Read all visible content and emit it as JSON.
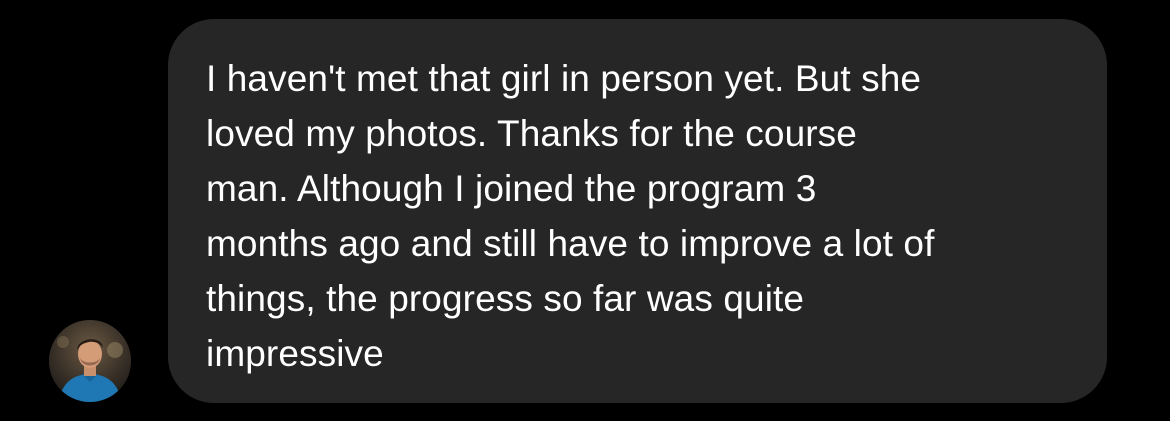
{
  "conversation": {
    "message": {
      "sender_avatar_icon": "user-avatar-photo",
      "lines": [
        "I haven't met that girl in person yet. But she",
        "loved my photos. Thanks for the course",
        "man. Although I joined the program 3",
        "months ago and still have to improve a lot of",
        "things, the progress so far was quite",
        "impressive"
      ]
    }
  },
  "colors": {
    "background": "#000000",
    "bubble": "#262626",
    "text": "#ffffff",
    "avatar_shirt": "#1f78b4"
  }
}
